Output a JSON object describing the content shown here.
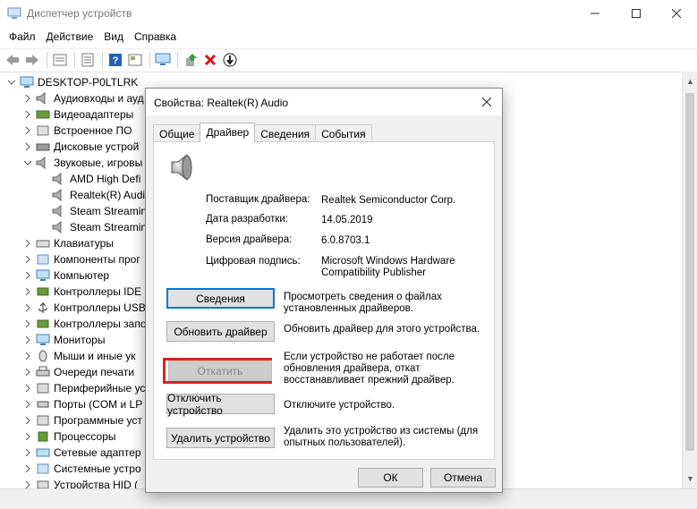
{
  "window": {
    "title": "Диспетчер устройств",
    "controls": {
      "minimize": "—",
      "maximize": "☐",
      "close": "✕"
    }
  },
  "menu": [
    "Файл",
    "Действие",
    "Вид",
    "Справка"
  ],
  "toolbar_icons": [
    "back-arrow-icon",
    "forward-arrow-icon",
    "show-hide-icon",
    "properties-icon",
    "help-icon",
    "view-icon",
    "monitor-icon",
    "update-driver-icon",
    "uninstall-icon",
    "disable-icon"
  ],
  "tree": {
    "root": "DESKTOP-P0LTLRK",
    "items": [
      {
        "label": "Аудиовходы и ауд",
        "icon": "speaker-icon",
        "state": "collapsed"
      },
      {
        "label": "Видеоадаптеры",
        "icon": "display-adapter-icon",
        "state": "collapsed"
      },
      {
        "label": "Встроенное ПО",
        "icon": "firmware-icon",
        "state": "collapsed"
      },
      {
        "label": "Дисковые устрой",
        "icon": "disk-icon",
        "state": "collapsed"
      },
      {
        "label": "Звуковые, игровы",
        "icon": "speaker-icon",
        "state": "expanded"
      },
      {
        "label": "AMD High Defi",
        "icon": "speaker-icon",
        "child": true
      },
      {
        "label": "Realtek(R) Audi",
        "icon": "speaker-icon",
        "child": true
      },
      {
        "label": "Steam Streamin",
        "icon": "speaker-icon",
        "child": true
      },
      {
        "label": "Steam Streamin",
        "icon": "speaker-icon",
        "child": true
      },
      {
        "label": "Клавиатуры",
        "icon": "keyboard-icon",
        "state": "collapsed"
      },
      {
        "label": "Компоненты прог",
        "icon": "component-icon",
        "state": "collapsed"
      },
      {
        "label": "Компьютер",
        "icon": "computer-icon",
        "state": "collapsed"
      },
      {
        "label": "Контроллеры IDE",
        "icon": "controller-icon",
        "state": "collapsed"
      },
      {
        "label": "Контроллеры USB",
        "icon": "usb-icon",
        "state": "collapsed"
      },
      {
        "label": "Контроллеры запо",
        "icon": "controller-icon",
        "state": "collapsed"
      },
      {
        "label": "Мониторы",
        "icon": "monitor-icon",
        "state": "collapsed"
      },
      {
        "label": "Мыши и иные ук",
        "icon": "mouse-icon",
        "state": "collapsed"
      },
      {
        "label": "Очереди печати",
        "icon": "printer-icon",
        "state": "collapsed"
      },
      {
        "label": "Периферийные ус",
        "icon": "peripheral-icon",
        "state": "collapsed"
      },
      {
        "label": "Порты (COM и LP",
        "icon": "port-icon",
        "state": "collapsed"
      },
      {
        "label": "Программные уст",
        "icon": "software-device-icon",
        "state": "collapsed"
      },
      {
        "label": "Процессоры",
        "icon": "cpu-icon",
        "state": "collapsed"
      },
      {
        "label": "Сетевые адаптер",
        "icon": "network-icon",
        "state": "collapsed"
      },
      {
        "label": "Системные устро",
        "icon": "system-icon",
        "state": "collapsed"
      },
      {
        "label": "Устройства HID (",
        "icon": "hid-icon",
        "state": "collapsed"
      }
    ]
  },
  "dialog": {
    "title": "Свойства: Realtek(R) Audio",
    "tabs": [
      "Общие",
      "Драйвер",
      "Сведения",
      "События"
    ],
    "active_tab": "Драйвер",
    "info": [
      {
        "label": "Поставщик драйвера:",
        "value": "Realtek Semiconductor Corp."
      },
      {
        "label": "Дата разработки:",
        "value": "14.05.2019"
      },
      {
        "label": "Версия драйвера:",
        "value": "6.0.8703.1"
      },
      {
        "label": "Цифровая подпись:",
        "value": "Microsoft Windows Hardware Compatibility Publisher"
      }
    ],
    "actions": [
      {
        "button": "Сведения",
        "desc": "Просмотреть сведения о файлах установленных драйверов."
      },
      {
        "button": "Обновить драйвер",
        "desc": "Обновить драйвер для этого устройства."
      },
      {
        "button": "Откатить",
        "desc": "Если устройство не работает после обновления драйвера, откат восстанавливает прежний драйвер.",
        "disabled": true
      },
      {
        "button": "Отключить устройство",
        "desc": "Отключите устройство."
      },
      {
        "button": "Удалить устройство",
        "desc": "Удалить это устройство из системы (для опытных пользователей)."
      }
    ],
    "ok": "ОК",
    "cancel": "Отмена"
  },
  "colors": {
    "highlight": "#d9222a",
    "focus": "#0078d7"
  }
}
